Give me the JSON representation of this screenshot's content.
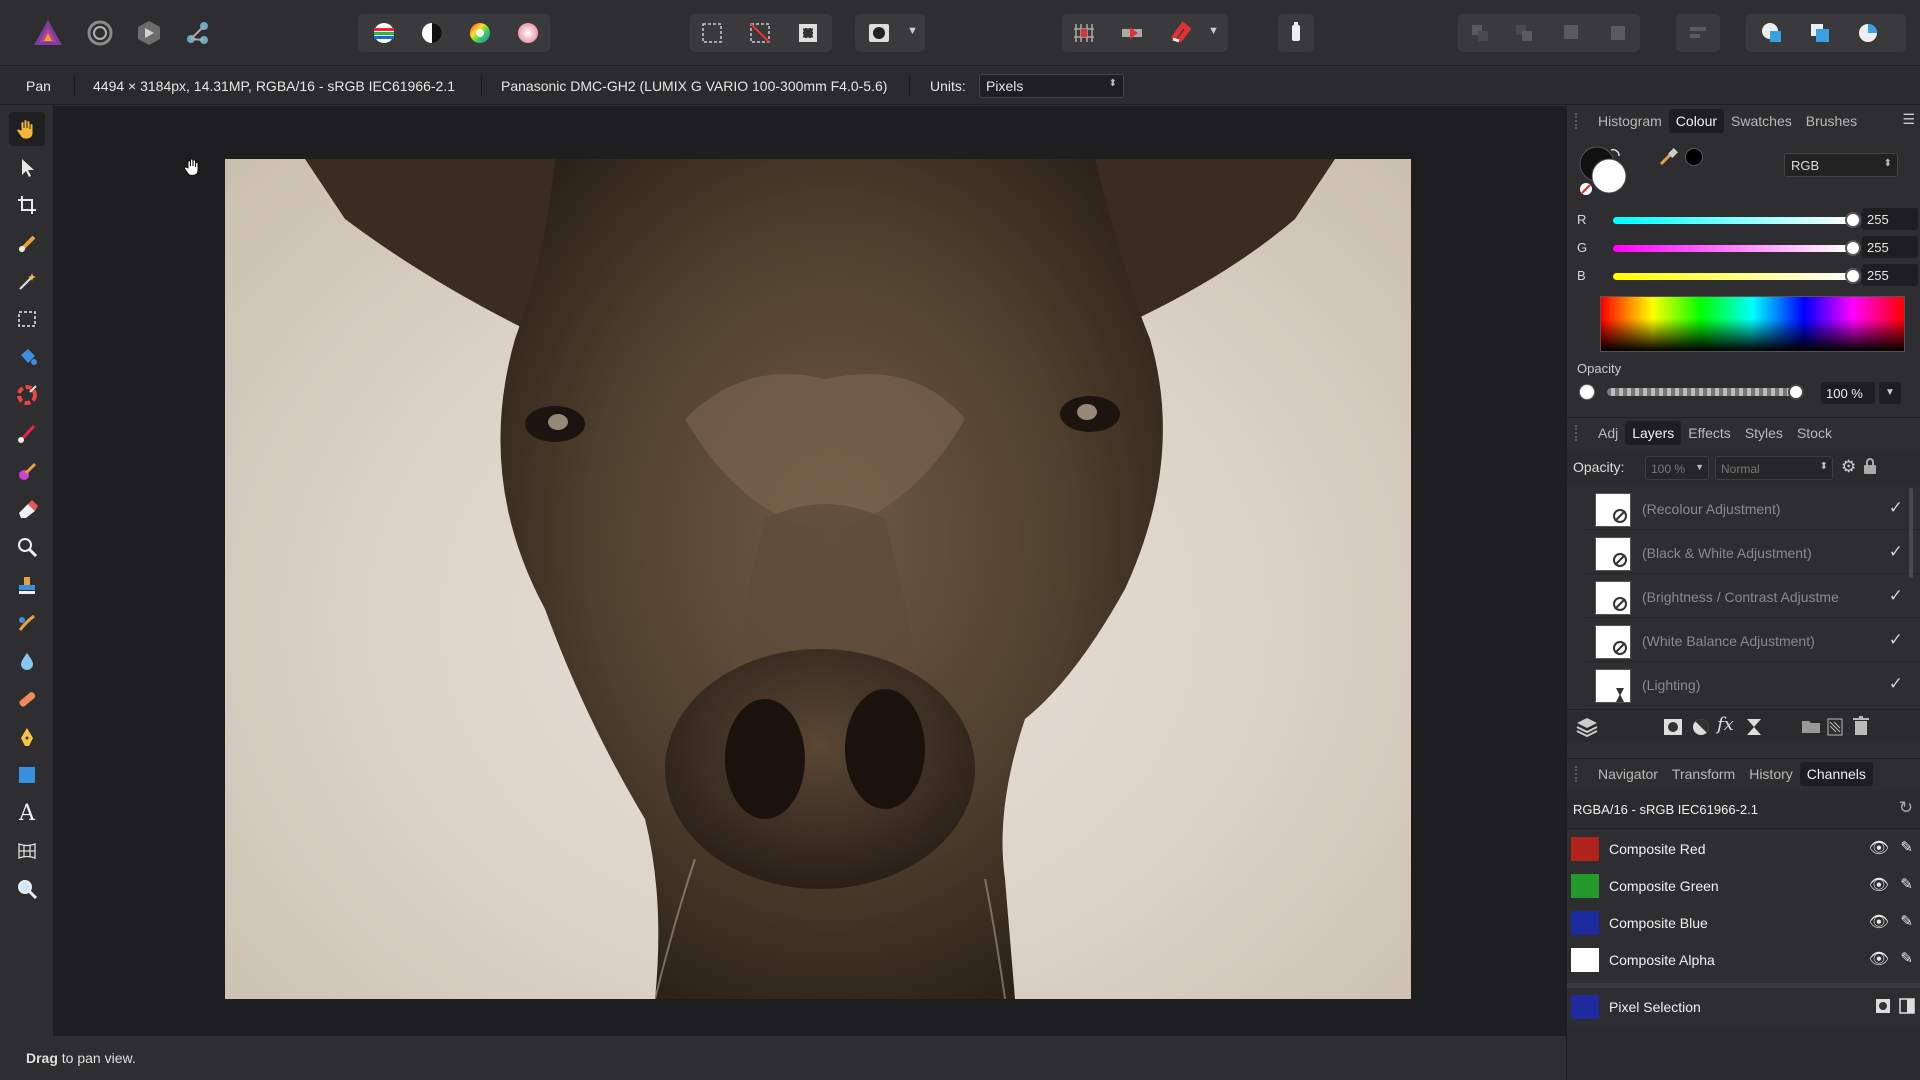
{
  "context": {
    "tool_name": "Pan",
    "image_info": "4494 × 3184px, 14.31MP, RGBA/16 - sRGB IEC61966-2.1",
    "camera_info": "Panasonic DMC-GH2 (LUMIX G VARIO 100-300mm F4.0-5.6)",
    "units_label": "Units:",
    "units_value": "Pixels"
  },
  "colour_panel": {
    "tabs": [
      "Histogram",
      "Colour",
      "Swatches",
      "Brushes"
    ],
    "active_tab": "Colour",
    "model": "RGB",
    "channels": [
      {
        "label": "R",
        "value": "255"
      },
      {
        "label": "G",
        "value": "255"
      },
      {
        "label": "B",
        "value": "255"
      }
    ],
    "opacity_label": "Opacity",
    "opacity_value": "100 %"
  },
  "layers_panel": {
    "tabs": [
      "Adj",
      "Layers",
      "Effects",
      "Styles",
      "Stock"
    ],
    "active_tab": "Layers",
    "opacity_label": "Opacity:",
    "opacity_value": "100 %",
    "blend_mode": "Normal",
    "layers": [
      {
        "name": "(Recolour Adjustment)",
        "visible": true
      },
      {
        "name": "(Black & White Adjustment)",
        "visible": true
      },
      {
        "name": "(Brightness / Contrast Adjustme",
        "visible": true
      },
      {
        "name": "(White Balance Adjustment)",
        "visible": true
      },
      {
        "name": "(Lighting)",
        "visible": true
      }
    ]
  },
  "channels_panel": {
    "tabs": [
      "Navigator",
      "Transform",
      "History",
      "Channels"
    ],
    "active_tab": "Channels",
    "header": "RGBA/16 - sRGB IEC61966-2.1",
    "channels": [
      {
        "name": "Composite Red",
        "color": "#c0201c"
      },
      {
        "name": "Composite Green",
        "color": "#22a02a"
      },
      {
        "name": "Composite Blue",
        "color": "#1c2a9e"
      },
      {
        "name": "Composite Alpha",
        "color": "#ffffff"
      }
    ],
    "pixel_selection": {
      "name": "Pixel Selection",
      "color": "#1e2aa0"
    }
  },
  "status": {
    "bold": "Drag",
    "text": " to pan view."
  },
  "colors": {
    "accent": "#1e1e20",
    "photo_tone": "#7a6650"
  }
}
